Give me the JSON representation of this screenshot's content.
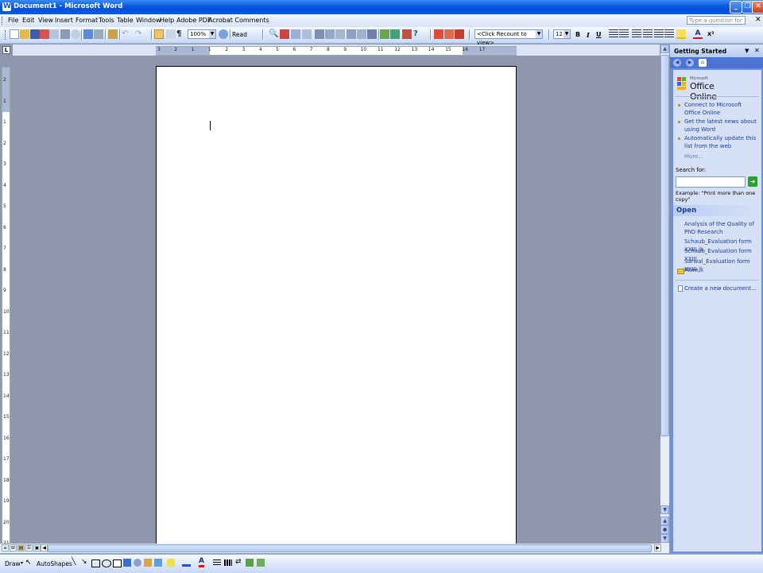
{
  "window": {
    "title": "Document1 - Microsoft Word"
  },
  "menu": {
    "items": [
      "File",
      "Edit",
      "View",
      "Insert",
      "Format",
      "Tools",
      "Table",
      "Window",
      "Help",
      "Adobe PDF",
      "Acrobat Comments"
    ],
    "ask_placeholder": "Type a question for help"
  },
  "toolbar": {
    "zoom": "100%",
    "read_label": "Read",
    "recount": "<Click Recount to view>",
    "font_size": "12",
    "bold": "B",
    "italic": "I",
    "underline": "U"
  },
  "ruler": {
    "h_ticks": [
      "3",
      "2",
      "1",
      "1",
      "2",
      "3",
      "4",
      "5",
      "6",
      "7",
      "8",
      "9",
      "10",
      "11",
      "12",
      "13",
      "14",
      "15",
      "16",
      "17"
    ],
    "v_ticks": [
      "2",
      "1",
      "1",
      "2",
      "3",
      "4",
      "5",
      "6",
      "7",
      "8",
      "9",
      "10",
      "11",
      "12",
      "13",
      "14",
      "15",
      "16",
      "17",
      "18",
      "19",
      "20",
      "21"
    ]
  },
  "drawing_toolbar": {
    "draw_label": "Draw",
    "autoshapes_label": "AutoShapes"
  },
  "task_pane": {
    "title": "Getting Started",
    "logo_small": "Microsoft",
    "logo_text": "Office Online",
    "links": [
      "Connect to Microsoft Office Online",
      "Get the latest news about using Word",
      "Automatically update this list from the web"
    ],
    "more": "More...",
    "search_label": "Search for:",
    "example": "Example:  \"Print more than one copy\"",
    "open_header": "Open",
    "recent_files": [
      "Analysis of the Quality of PhD Research",
      "Schaub_Evaluation form XXIII jk",
      "Schaub_Evaluation form XXIII",
      "Sarwal_Evaluation form XXIII jk"
    ],
    "open_more": "More...",
    "new_document": "Create a new document..."
  },
  "colors": {
    "titlebar": "#0a58e0",
    "workspace": "#8e97ad",
    "taskpane": "#d6e0f7",
    "link": "#1c3e9c"
  }
}
